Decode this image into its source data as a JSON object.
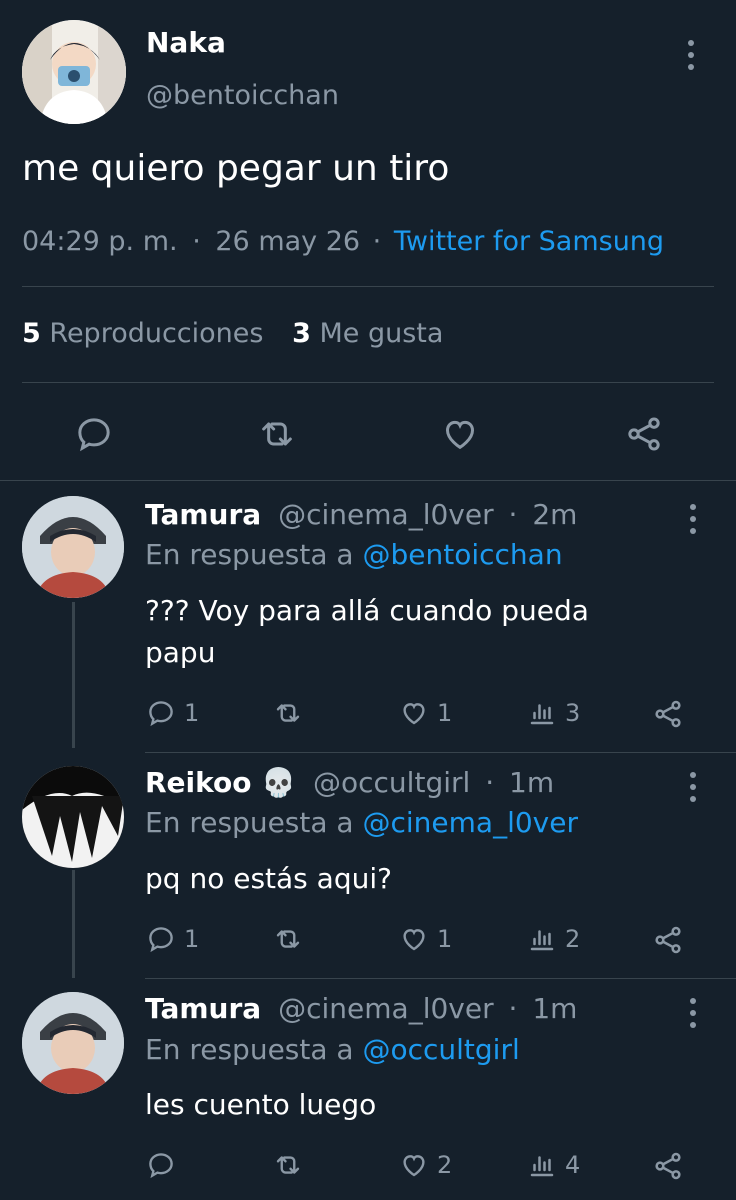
{
  "main_tweet": {
    "name": "Naka",
    "handle": "@bentoicchan",
    "text": "me quiero pegar un tiro",
    "time": "04:29 p. m.",
    "sep1": "·",
    "date": "26 may 26",
    "sep2": "·",
    "source": "Twitter for Samsung",
    "views_count": "5",
    "views_label": "Reproducciones",
    "likes_count": "3",
    "likes_label": "Me gusta"
  },
  "replies": [
    {
      "name": "Tamura",
      "handle": "@cinema_l0ver",
      "sep": "·",
      "time": "2m",
      "reply_prefix": "En respuesta a",
      "reply_to": "@bentoicchan",
      "text_line1": "??? Voy para allá cuando pueda",
      "text_line2": "papu",
      "replies_count": "1",
      "likes_count": "1",
      "views_count": "3"
    },
    {
      "name": "Reikoo 💀",
      "handle": "@occultgirl",
      "sep": "·",
      "time": "1m",
      "reply_prefix": "En respuesta a",
      "reply_to": "@cinema_l0ver",
      "text_line1": "pq no estás aqui?",
      "replies_count": "1",
      "likes_count": "1",
      "views_count": "2"
    },
    {
      "name": "Tamura",
      "handle": "@cinema_l0ver",
      "sep": "·",
      "time": "1m",
      "reply_prefix": "En respuesta a",
      "reply_to": "@occultgirl",
      "text_line1": "les cuento luego",
      "likes_count": "2",
      "views_count": "4"
    }
  ],
  "colors": {
    "background": "#15202b",
    "link": "#1d9bf0",
    "muted": "#8b98a5",
    "divider": "#38444d"
  },
  "icons": [
    "reply-icon",
    "retweet-icon",
    "like-icon",
    "share-icon",
    "views-icon",
    "more-icon"
  ]
}
